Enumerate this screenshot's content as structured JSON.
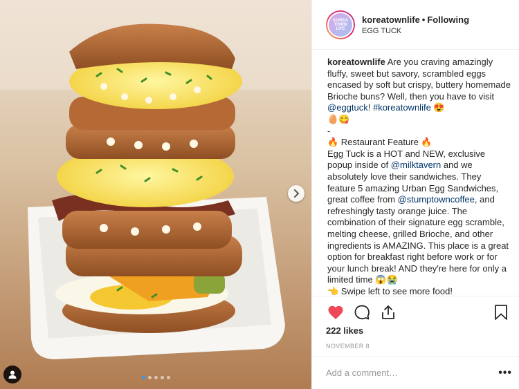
{
  "post": {
    "username": "koreatownlife",
    "separator": "•",
    "follow_status": "Following",
    "location": "EGG TUCK",
    "avatar_text": "KOREA TOWN LIFE",
    "caption": {
      "username": "koreatownlife",
      "p1_a": "Are you craving amazingly fluffy, sweet but savory, scrambled eggs encased by soft but crispy, buttery homemade Brioche buns? Well, then you have to visit ",
      "mention_eggtuck": "@eggtuck",
      "p1_b": "! ",
      "hashtag": "#koreatownlife",
      "p1_emoji": " 😍",
      "p1_emoji2": "🥚😋",
      "dash": "-",
      "p2_heading": "🔥 Restaurant Feature 🔥",
      "p2_a": "Egg Tuck is a HOT and NEW, exclusive popup inside of ",
      "mention_milktavern": "@milktavern",
      "p2_b": " and we absolutely love their sandwiches. They feature 5 amazing Urban Egg Sandwiches, great coffee from ",
      "mention_stumptown": "@stumptowncoffee",
      "p2_c": ", and refreshingly tasty orange juice. The combination of their signature egg scramble, melting cheese, grilled Brioche, and other ingredients is AMAZING. This place is a great option for breakfast right before work or for your lunch break! AND they're here for only a limited time 😱😭",
      "p3": "👈 Swipe left to see more food!"
    },
    "likes": "222 likes",
    "date": "NOVEMBER 8",
    "comment_placeholder": "Add a comment…",
    "more": "•••"
  },
  "carousel": {
    "slides": 5,
    "active": 0
  },
  "colors": {
    "heart": "#ed4956",
    "dot_active": "#3897f0",
    "link": "#003569"
  },
  "icons": [
    "heart-icon",
    "comment-icon",
    "share-icon",
    "bookmark-icon",
    "chevron-right-icon",
    "user-tag-icon"
  ]
}
